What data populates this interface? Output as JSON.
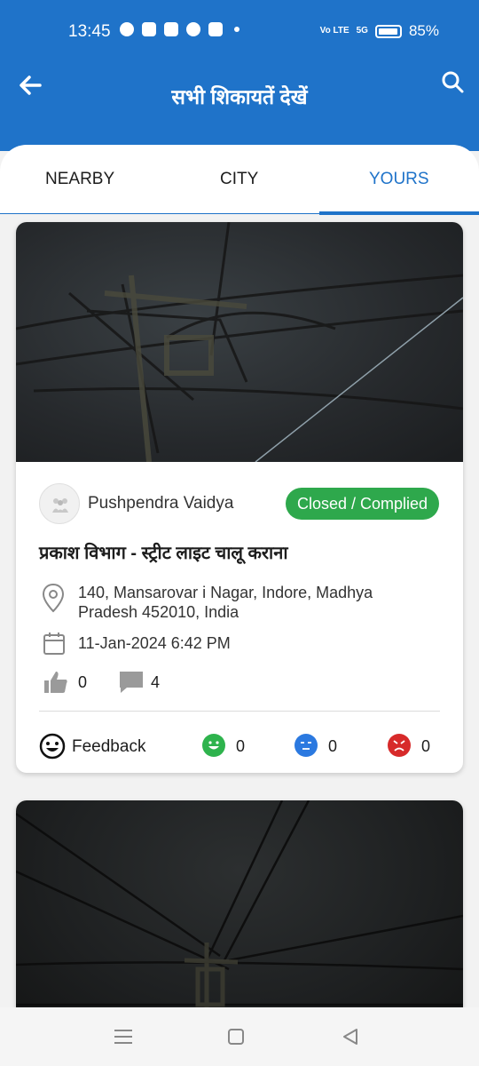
{
  "status_bar": {
    "time": "13:45",
    "battery": "85%",
    "network": "5G",
    "volte": "Vo LTE"
  },
  "header": {
    "title": "सभी शिकायतें देखें"
  },
  "tabs": [
    {
      "label": "NEARBY"
    },
    {
      "label": "CITY"
    },
    {
      "label": "YOURS"
    }
  ],
  "active_tab": "YOURS",
  "colors": {
    "primary": "#1f73c9",
    "status_closed": "#2ea84c",
    "happy": "#2eb34d",
    "neutral": "#2b79e0",
    "angry": "#d72a2a"
  },
  "complaints": [
    {
      "user": "Pushpendra Vaidya",
      "status": "Closed / Complied",
      "title": "प्रकाश विभाग - स्ट्रीट लाइट चालू कराना",
      "address": "140, Mansarovar i Nagar, Indore, Madhya Pradesh 452010, India",
      "date": "11-Jan-2024 6:42 PM",
      "likes": "0",
      "comments": "4",
      "feedback_label": "Feedback",
      "feedback": {
        "happy": "0",
        "neutral": "0",
        "angry": "0"
      }
    }
  ],
  "icons": [
    "back-arrow-icon",
    "search-icon",
    "location-pin-icon",
    "calendar-icon",
    "thumbs-up-icon",
    "comment-icon",
    "feedback-smiley-icon",
    "menu-icon",
    "home-icon",
    "back-icon"
  ]
}
